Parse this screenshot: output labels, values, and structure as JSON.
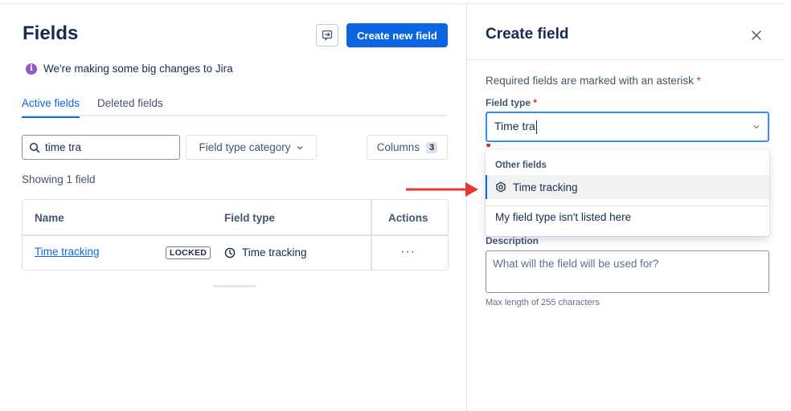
{
  "page": {
    "title": "Fields",
    "feedback_icon": "feedback-icon",
    "create_button": "Create new field",
    "notice": "We're making some big changes to Jira",
    "notice_icon": "info-icon",
    "tabs": [
      {
        "label": "Active fields",
        "active": true
      },
      {
        "label": "Deleted fields",
        "active": false
      }
    ],
    "search": {
      "value": "time tra",
      "icon": "search-icon"
    },
    "filter_label": "Field type category",
    "columns": {
      "label": "Columns",
      "count": "3"
    },
    "showing": "Showing 1 field",
    "table": {
      "headers": {
        "name": "Name",
        "type": "Field type",
        "actions": "Actions"
      },
      "rows": [
        {
          "name": "Time tracking",
          "lozenge": "LOCKED",
          "type": "Time tracking",
          "type_icon": "clock-icon",
          "actions": "···"
        }
      ]
    }
  },
  "drawer": {
    "title": "Create field",
    "close_icon": "close-icon",
    "required_note": "Required fields are marked with an asterisk",
    "asterisk": "*",
    "field_type_label": "Field type",
    "field_type_value": "Time tra",
    "dropdown": {
      "group": "Other fields",
      "options": [
        {
          "label": "Time tracking",
          "icon": "gear-icon"
        }
      ],
      "other": "My field type isn't listed here"
    },
    "description_label": "Description",
    "description_placeholder": "What will the field will be used for?",
    "helper": "Max length of 255 characters"
  },
  "colors": {
    "primary": "#0c66e4",
    "annotation_arrow": "#e53935",
    "required": "#c9372c",
    "info": "#8f59d0"
  }
}
